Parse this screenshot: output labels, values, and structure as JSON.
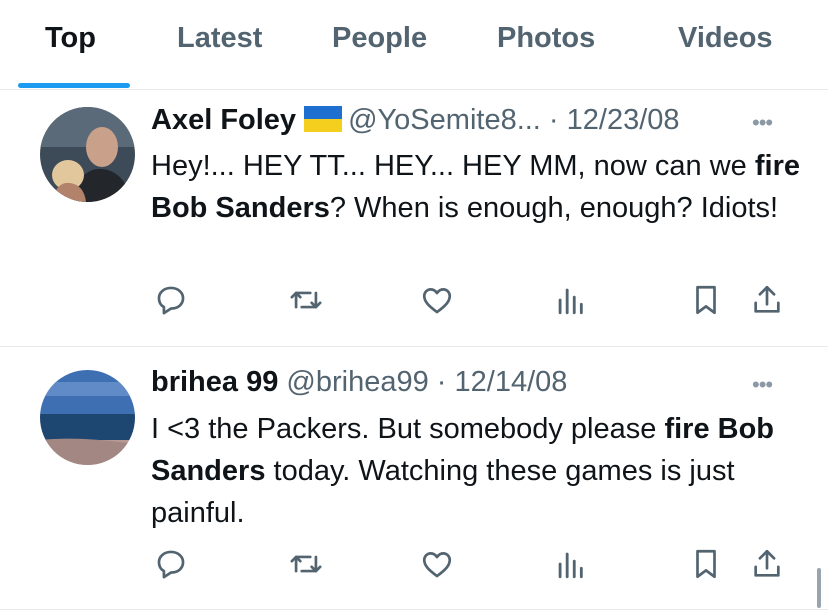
{
  "tabs": [
    {
      "label": "Top",
      "active": true
    },
    {
      "label": "Latest",
      "active": false
    },
    {
      "label": "People",
      "active": false
    },
    {
      "label": "Photos",
      "active": false
    },
    {
      "label": "Videos",
      "active": false
    }
  ],
  "tweets": [
    {
      "name": "Axel Foley",
      "flag": "ukraine-flag",
      "handle": "@YoSemite8...",
      "sep": " · ",
      "date": "12/23/08",
      "text_parts": [
        "Hey!... HEY TT... HEY... HEY MM, now can we ",
        "fire Bob Sanders",
        "? When is enough, enough? Idiots!"
      ]
    },
    {
      "name": "brihea 99",
      "handle": "@brihea99",
      "sep": " · ",
      "date": "12/14/08",
      "text_parts": [
        "I <3 the Packers. But somebody please ",
        "fire Bob Sanders",
        " today. Watching these games is just painful."
      ]
    }
  ],
  "icons": {
    "reply": "reply-icon",
    "retweet": "retweet-icon",
    "like": "like-icon",
    "views": "views-icon",
    "bookmark": "bookmark-icon",
    "share": "share-icon",
    "more": "more-icon"
  },
  "colors": {
    "accent": "#1d9bf0",
    "secondary_text": "#536471",
    "primary_text": "#0f1419",
    "divider": "#e7e9ea"
  },
  "more_glyph": "•••"
}
